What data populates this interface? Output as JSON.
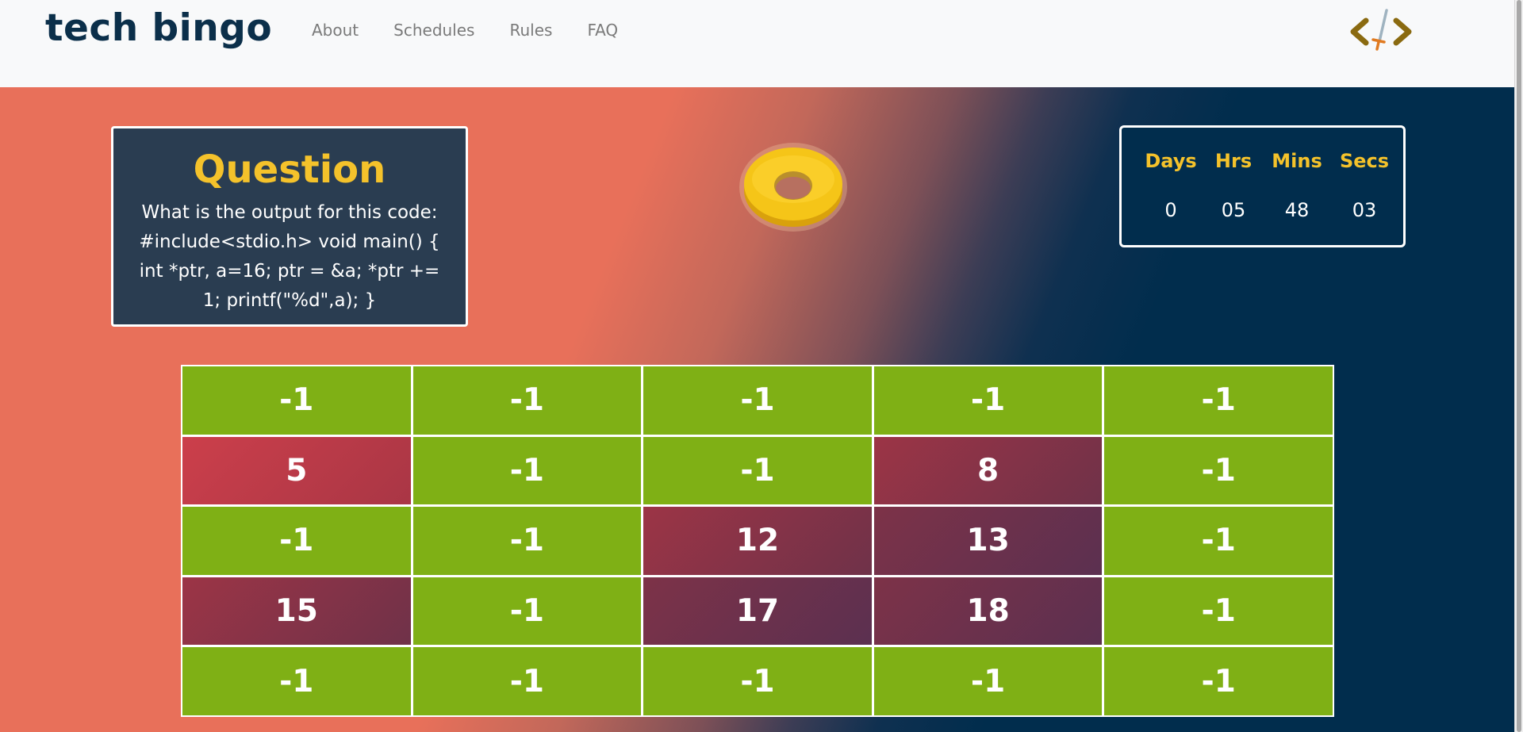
{
  "brand": {
    "name": "tech bingo"
  },
  "nav": {
    "items": [
      {
        "label": "About"
      },
      {
        "label": "Schedules"
      },
      {
        "label": "Rules"
      },
      {
        "label": "FAQ"
      }
    ]
  },
  "logo": {
    "icon": "code-sword-icon",
    "color": "#8a6a10"
  },
  "question": {
    "title": "Question",
    "text": "What is the output for this code: #include<stdio.h> void main() { int *ptr, a=16; ptr = &a; *ptr += 1; printf(\"%d\",a); }"
  },
  "coin": {
    "icon": "gold-ring-coin-icon",
    "color": "#f5c518"
  },
  "timer": {
    "labels": {
      "days": "Days",
      "hrs": "Hrs",
      "mins": "Mins",
      "secs": "Secs"
    },
    "values": {
      "days": "0",
      "hrs": "05",
      "mins": "48",
      "secs": "03"
    }
  },
  "board": {
    "rows": [
      [
        "-1",
        "-1",
        "-1",
        "-1",
        "-1"
      ],
      [
        "5",
        "-1",
        "-1",
        "8",
        "-1"
      ],
      [
        "-1",
        "-1",
        "12",
        "13",
        "-1"
      ],
      [
        "15",
        "-1",
        "17",
        "18",
        "-1"
      ],
      [
        "-1",
        "-1",
        "-1",
        "-1",
        "-1"
      ]
    ]
  },
  "colors": {
    "unmarked": "#7fb015",
    "marked": "#8a3347",
    "accent": "#f4c22b",
    "navy": "#012d4d",
    "coral": "#e8705a"
  }
}
